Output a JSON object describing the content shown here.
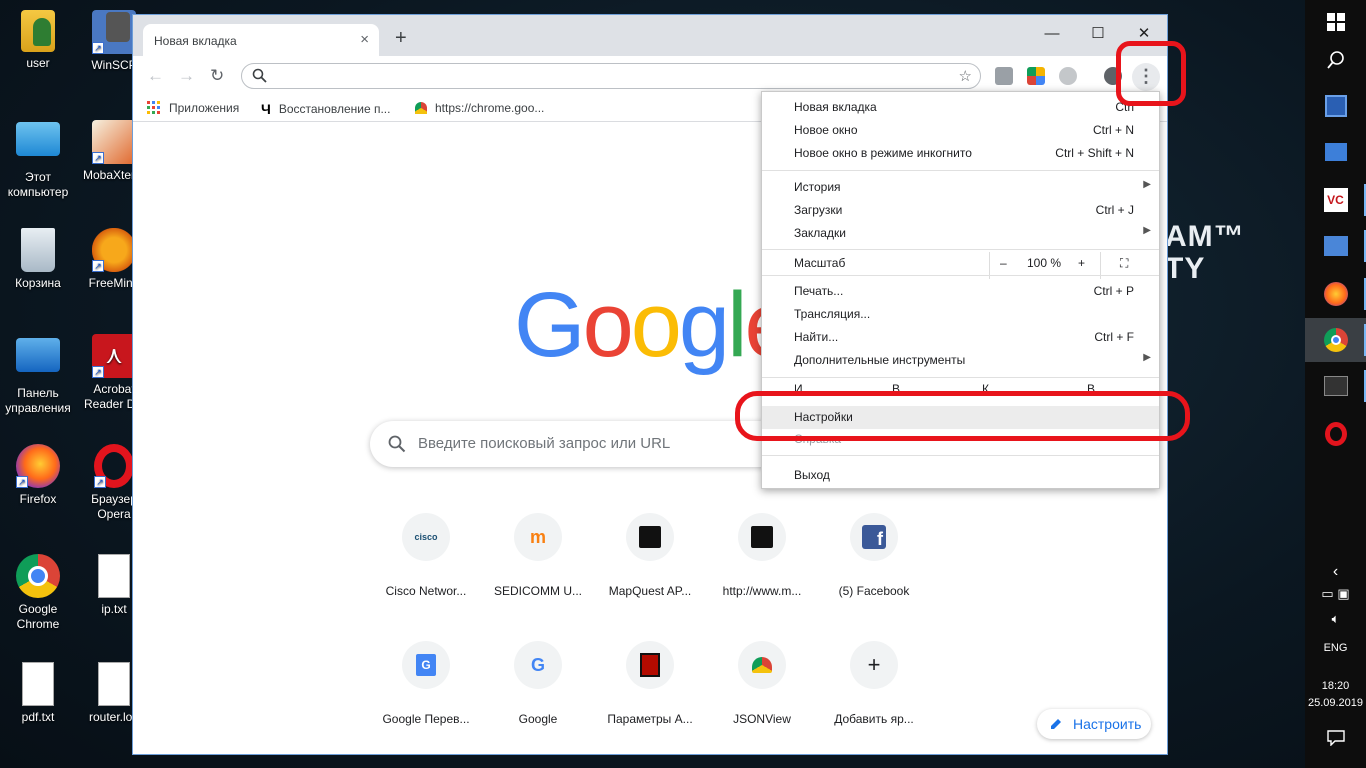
{
  "desktop": {
    "icons": [
      {
        "label": "user"
      },
      {
        "label": "WinSCP"
      },
      {
        "label": "Этот компьютер"
      },
      {
        "label": "MobaXterm"
      },
      {
        "label": "Корзина"
      },
      {
        "label": "FreeMind"
      },
      {
        "label": "Панель управления"
      },
      {
        "label": "Acrobat Reader DC"
      },
      {
        "label": "Firefox"
      },
      {
        "label": "Браузер Opera"
      },
      {
        "label": "Google Chrome"
      },
      {
        "label": "ip.txt"
      },
      {
        "label": "pdf.txt"
      },
      {
        "label": "router.log"
      }
    ],
    "wallpaper_text_1": "AM™",
    "wallpaper_text_2": "TY"
  },
  "taskbar": {
    "lang": "ENG",
    "time": "18:20",
    "date": "25.09.2019"
  },
  "browser": {
    "tab_title": "Новая вкладка",
    "tab_close": "×",
    "new_tab": "+",
    "window": {
      "minimize": "—",
      "maximize": "☐",
      "close": "✕"
    },
    "nav": {
      "back": "←",
      "forward": "→",
      "reload": "↻"
    },
    "star": "☆",
    "menu_button": "⋮",
    "bookmarks": [
      {
        "label": "Приложения"
      },
      {
        "label": "Восстановление п..."
      },
      {
        "label": "https://chrome.goo..."
      }
    ]
  },
  "newtab": {
    "logo": [
      "G",
      "o",
      "o",
      "g",
      "l",
      "e"
    ],
    "logo_colors": [
      "#4285f4",
      "#ea4335",
      "#fbbc05",
      "#4285f4",
      "#34a853",
      "#ea4335"
    ],
    "search_placeholder": "Введите поисковый запрос или URL",
    "tiles": [
      {
        "label": "Cisco Networ...",
        "icon": "cisco-icon"
      },
      {
        "label": "SEDICOMM U...",
        "icon": "moodle-icon"
      },
      {
        "label": "MapQuest AP...",
        "icon": "mapquest-icon"
      },
      {
        "label": "http://www.m...",
        "icon": "mapquest-icon"
      },
      {
        "label": "(5) Facebook",
        "icon": "facebook-icon"
      },
      {
        "label": "Google Перев...",
        "icon": "translate-icon"
      },
      {
        "label": "Google",
        "icon": "google-icon"
      },
      {
        "label": "Параметры А...",
        "icon": "acrobat-icon"
      },
      {
        "label": "JSONView",
        "icon": "chrome-store-icon"
      },
      {
        "label": "Добавить яр...",
        "icon": "add-icon"
      }
    ],
    "customize_label": "Настроить"
  },
  "menu": {
    "items": [
      {
        "label": "Новая вкладка",
        "shortcut": "Ctrl"
      },
      {
        "label": "Новое окно",
        "shortcut": "Ctrl + N"
      },
      {
        "label": "Новое окно в режиме инкогнито",
        "shortcut": "Ctrl + Shift + N"
      },
      {
        "label": "История",
        "shortcut": ""
      },
      {
        "label": "Загрузки",
        "shortcut": "Ctrl + J"
      },
      {
        "label": "Закладки",
        "shortcut": ""
      },
      {
        "label": "Печать...",
        "shortcut": "Ctrl + P"
      },
      {
        "label": "Трансляция...",
        "shortcut": ""
      },
      {
        "label": "Найти...",
        "shortcut": "Ctrl + F"
      },
      {
        "label": "Дополнительные инструменты",
        "shortcut": ""
      },
      {
        "label": "Настройки",
        "shortcut": ""
      },
      {
        "label": "Выход",
        "shortcut": ""
      }
    ],
    "zoom_label": "Масштаб",
    "zoom_minus": "–",
    "zoom_value": "100 %",
    "zoom_plus": "+",
    "edit_row_label": "И",
    "edit_row_2": "В",
    "edit_row_3": "К",
    "edit_row_4": "В",
    "help_label": "Справка"
  },
  "annotation_color": "#e8141b"
}
